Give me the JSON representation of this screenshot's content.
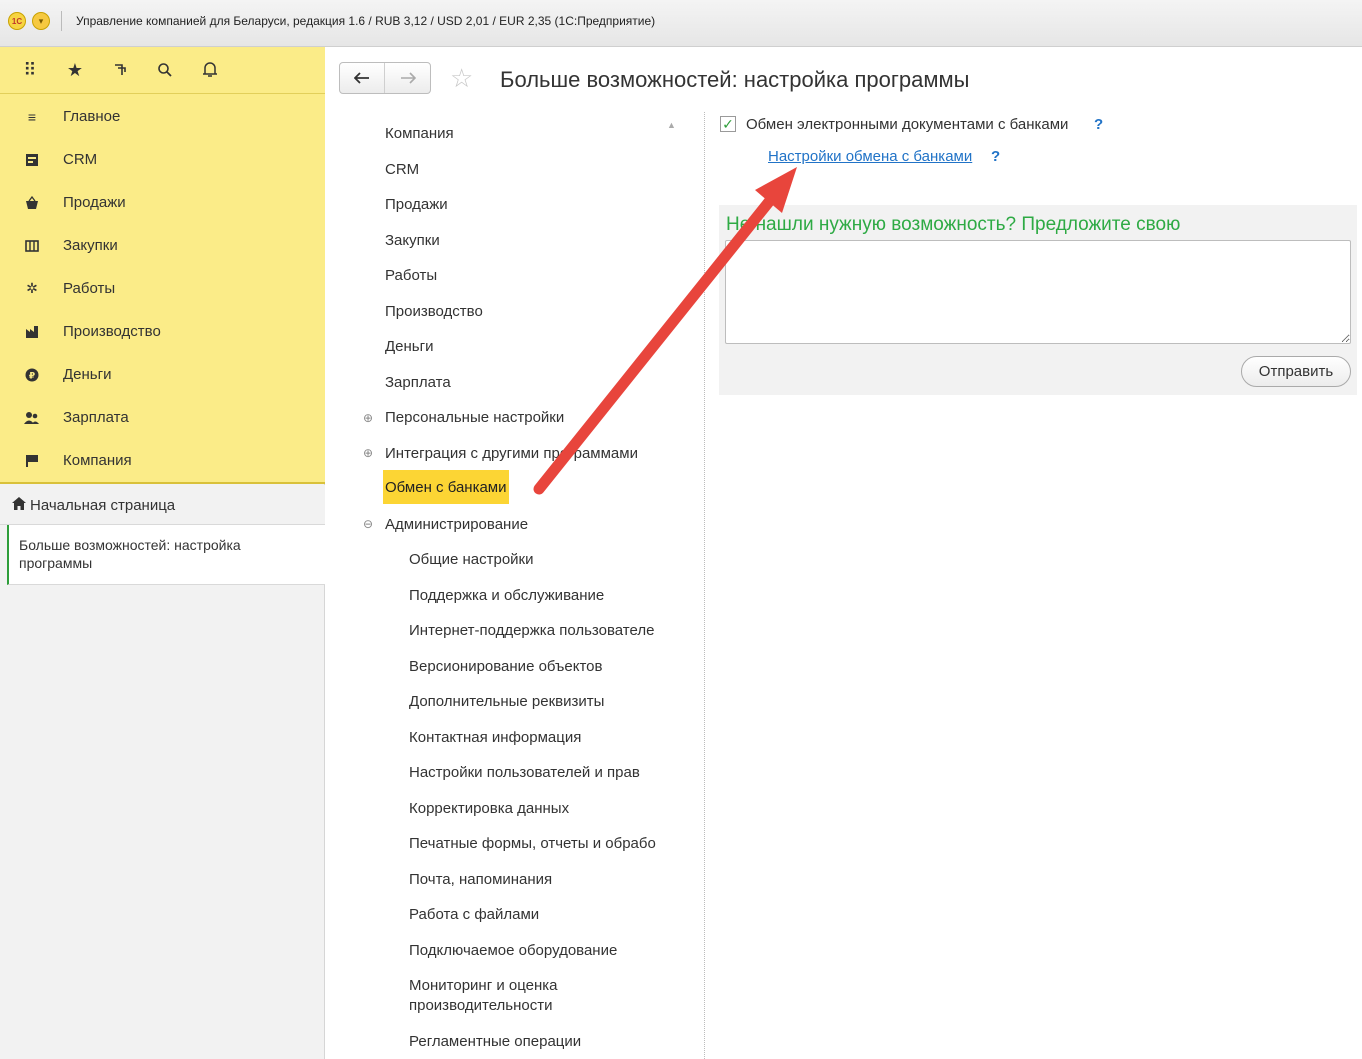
{
  "titlebar": {
    "logo": "1С",
    "menu_icon": "▾",
    "title": "Управление компанией для Беларуси, редакция 1.6 / RUB 3,12 / USD 2,01 / EUR 2,35  (1С:Предприятие)"
  },
  "sidebar": {
    "toolbar_icons": [
      "apps-grid-icon",
      "star-icon",
      "history-icon",
      "search-icon",
      "bell-icon"
    ],
    "items": [
      {
        "label": "Главное",
        "icon": "menu-lines-icon"
      },
      {
        "label": "CRM",
        "icon": "crm-icon"
      },
      {
        "label": "Продажи",
        "icon": "basket-icon"
      },
      {
        "label": "Закупки",
        "icon": "warehouse-icon"
      },
      {
        "label": "Работы",
        "icon": "tools-icon"
      },
      {
        "label": "Производство",
        "icon": "factory-icon"
      },
      {
        "label": "Деньги",
        "icon": "money-icon"
      },
      {
        "label": "Зарплата",
        "icon": "people-icon"
      },
      {
        "label": "Компания",
        "icon": "flag-icon"
      }
    ],
    "home": "Начальная страница",
    "open_window": "Больше возможностей: настройка программы"
  },
  "header": {
    "title": "Больше возможностей: настройка программы"
  },
  "sections": {
    "top": [
      "Компания",
      "CRM",
      "Продажи",
      "Закупки",
      "Работы",
      "Производство",
      "Деньги",
      "Зарплата"
    ],
    "personal": "Персональные настройки",
    "integration": "Интеграция с другими программами",
    "active": "Обмен с банками",
    "admin": "Администрирование",
    "admin_items": [
      "Общие настройки",
      "Поддержка и обслуживание",
      "Интернет-поддержка пользователе",
      "Версионирование объектов",
      "Дополнительные реквизиты",
      "Контактная информация",
      "Настройки пользователей и прав",
      "Корректировка данных",
      "Печатные формы, отчеты и обрабо",
      "Почта, напоминания",
      "Работа с файлами",
      "Подключаемое оборудование",
      "Мониторинг и оценка производительности",
      "Регламентные операции"
    ]
  },
  "content": {
    "checkbox_label": "Обмен электронными документами с банками",
    "checkbox_checked": true,
    "help_mark": "?",
    "link": "Настройки обмена с банками",
    "suggest_title": "Не нашли нужную возможность? Предложите свою",
    "suggest_value": "",
    "send_button": "Отправить"
  },
  "colors": {
    "sidebar_bg": "#fbec88",
    "active_section": "#fcd534",
    "accent_green": "#2eaa44",
    "link_blue": "#2173c7",
    "annotation_arrow": "#e8453c"
  }
}
